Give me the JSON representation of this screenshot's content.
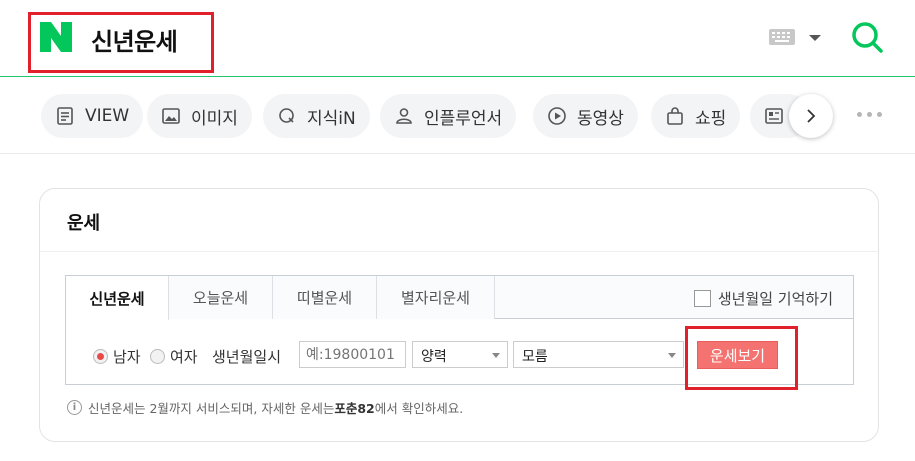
{
  "header": {
    "query": "신년운세",
    "brand_color": "#03c75a",
    "highlight_color": "#e0202b"
  },
  "tabs": [
    {
      "label": "VIEW",
      "icon": "document-icon"
    },
    {
      "label": "이미지",
      "icon": "image-icon"
    },
    {
      "label": "지식iN",
      "icon": "q-icon"
    },
    {
      "label": "인플루언서",
      "icon": "person-icon"
    },
    {
      "label": "동영상",
      "icon": "play-icon"
    },
    {
      "label": "쇼핑",
      "icon": "shopping-bag-icon"
    },
    {
      "label": "",
      "icon": "news-card-icon"
    }
  ],
  "card": {
    "title": "운세",
    "tabs": [
      "신년운세",
      "오늘운세",
      "띠별운세",
      "별자리운세"
    ],
    "active_tab": "신년운세",
    "remember_label": "생년월일 기억하기",
    "gender_male": "남자",
    "gender_female": "여자",
    "selected_gender": "남자",
    "birth_label": "생년월일시",
    "birth_placeholder": "예:19800101",
    "calendar_value": "양력",
    "time_value": "모름",
    "submit_label": "운세보기",
    "notice_prefix": "신년운세는 2월까지 서비스되며, 자세한 운세는 ",
    "notice_link": "포춘82",
    "notice_suffix": "에서 확인하세요."
  }
}
